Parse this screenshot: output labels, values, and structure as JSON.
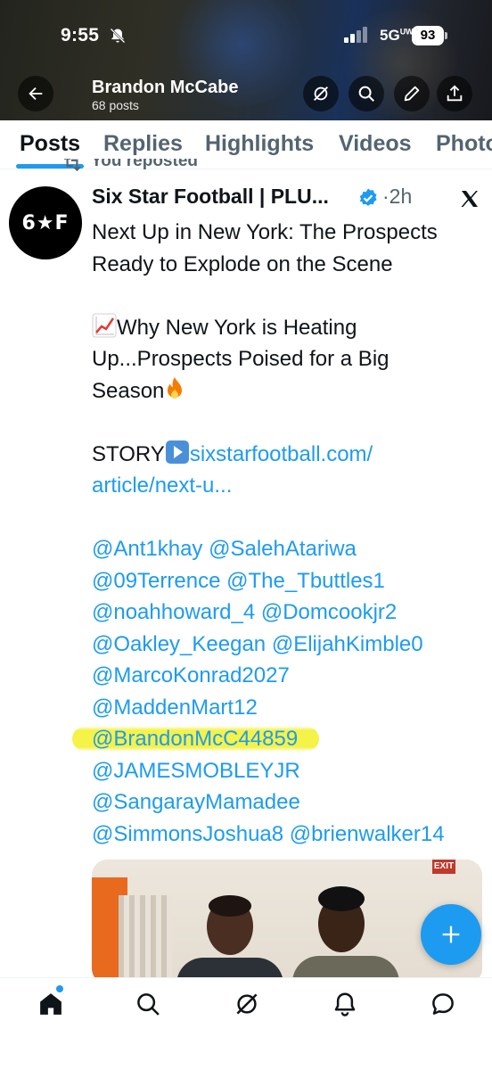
{
  "status_bar": {
    "time": "9:55",
    "network": "5G",
    "network_sup": "UW",
    "battery": "93"
  },
  "header": {
    "profile_name": "Brandon McCabe",
    "post_count": "68 posts"
  },
  "tabs": [
    {
      "label": "Posts",
      "active": true
    },
    {
      "label": "Replies",
      "active": false
    },
    {
      "label": "Highlights",
      "active": false
    },
    {
      "label": "Videos",
      "active": false
    },
    {
      "label": "Photos",
      "active": false
    }
  ],
  "post": {
    "reposted_label": "You reposted",
    "avatar_text": "6★F",
    "author": "Six Star Football | PLU...",
    "time": "·2h",
    "headline_line1": "Next Up in New York: The Prospects",
    "headline_line2": "Ready to Explode on the Scene",
    "para2_line1": "Why New York is Heating",
    "para2_line2": "Up...Prospects Poised for a Big",
    "para2_line3": "Season",
    "story_label": "STORY",
    "link_line1": "sixstarfootball.com/",
    "link_line2": "article/next-u...",
    "mentions": [
      "@Ant1khay",
      "@SalehAtariwa",
      "@09Terrence",
      "@The_Tbuttles1",
      "@noahhoward_4",
      "@Domcookjr2",
      "@Oakley_Keegan",
      "@ElijahKimble0",
      "@MarcoKonrad2027",
      "@MaddenMart12",
      "@BrandonMcC44859",
      "@JAMESMOBLEYJR",
      "@SangarayMamadee",
      "@SimmonsJoshua8",
      "@brienwalker14"
    ],
    "media_exit_sign": "EXIT"
  },
  "colors": {
    "accent": "#1d9bf0",
    "text": "#0f1419",
    "muted": "#536471",
    "highlight": "#f3f028"
  },
  "icons": {
    "back": "arrow-left-icon",
    "grok": "grok-icon",
    "search": "search-icon",
    "edit": "edit-icon",
    "share": "share-icon",
    "verified": "verified-badge-icon",
    "x": "x-logo-icon",
    "compose": "plus-icon",
    "home": "home-icon",
    "notifications": "bell-icon",
    "messages": "message-icon"
  }
}
